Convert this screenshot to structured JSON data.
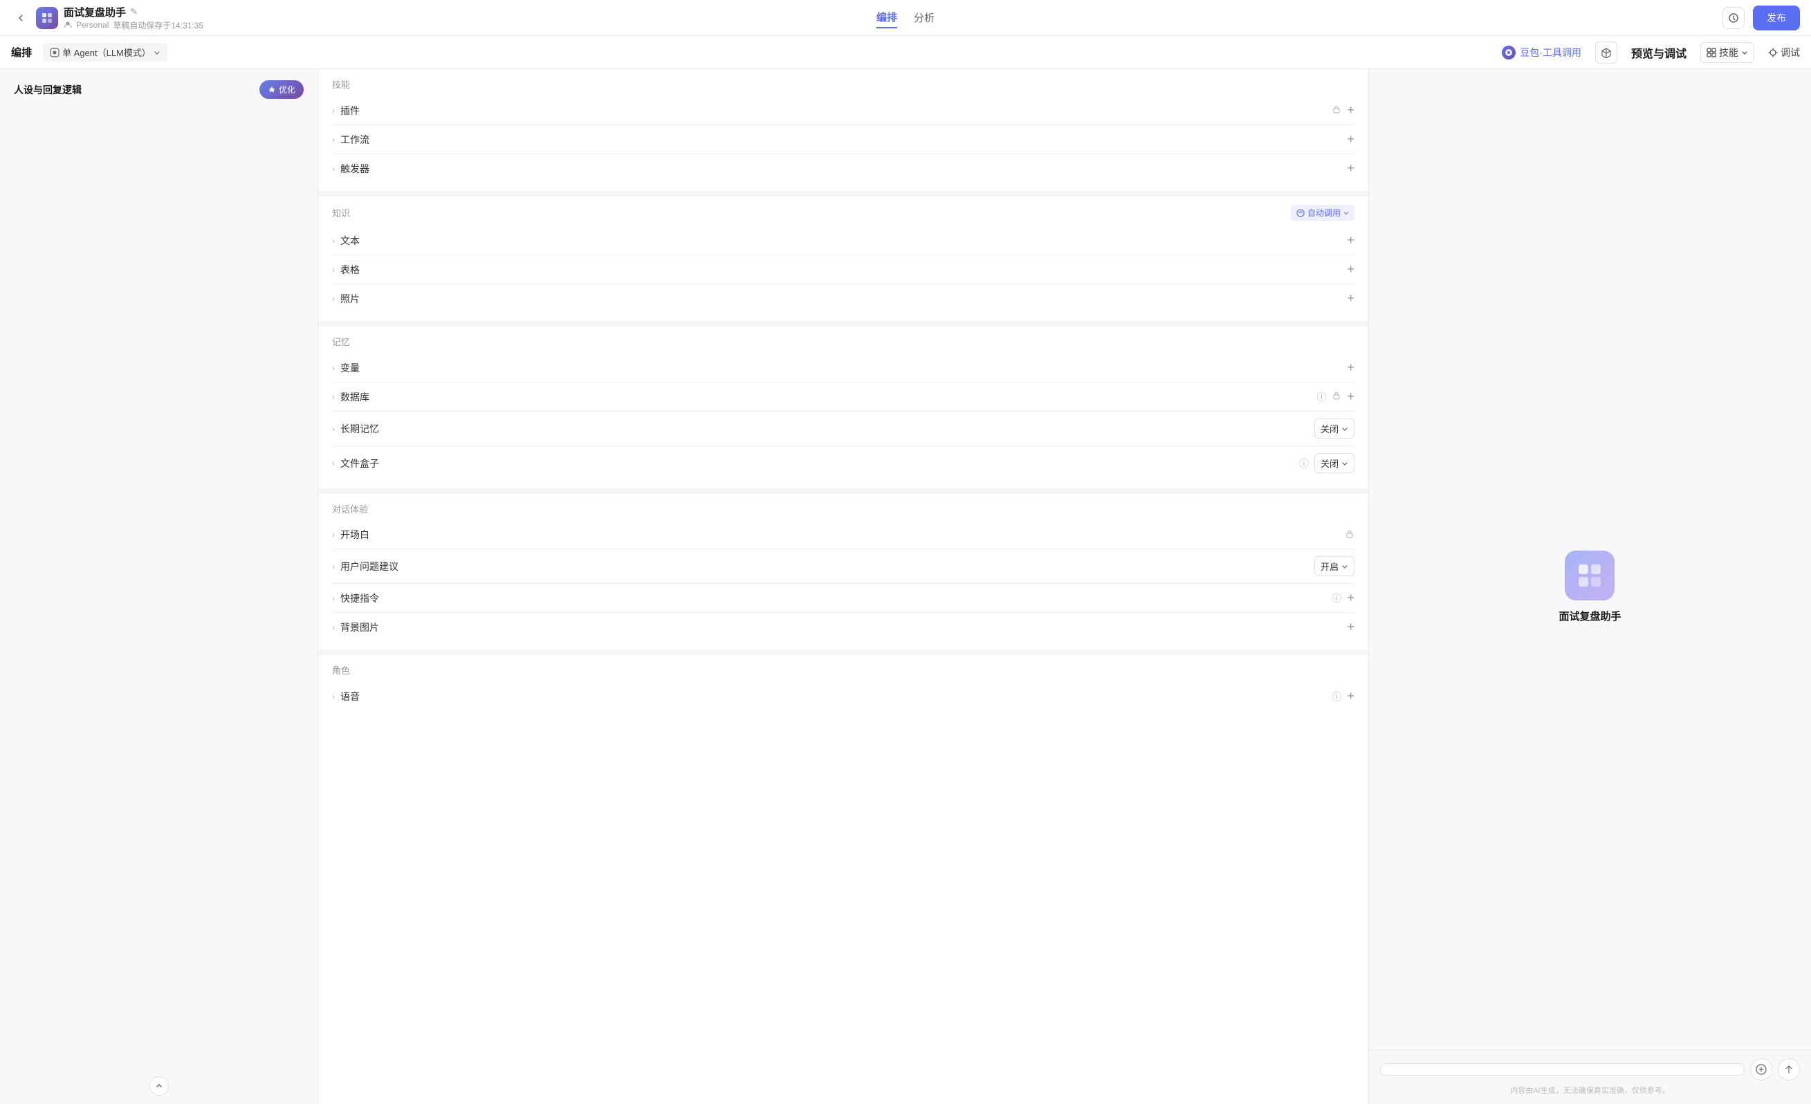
{
  "topbar": {
    "back_label": "‹",
    "app_icon": "🗂",
    "app_title": "面试复盘助手",
    "edit_icon": "✎",
    "personal_label": "Personal",
    "autosave_label": "草稿自动保存于14:31:35",
    "nav_tabs": [
      {
        "id": "edit",
        "label": "编排",
        "active": true
      },
      {
        "id": "analysis",
        "label": "分析",
        "active": false
      }
    ],
    "history_icon": "🕐",
    "publish_label": "发布"
  },
  "second_toolbar": {
    "label": "编排",
    "agent_mode_label": "单 Agent（LLM模式）",
    "doubao_tools_label": "豆包·工具调用",
    "plugin_icon": "⬡",
    "preview_label": "预览与调试",
    "skills_label": "技能",
    "debug_label": "调试"
  },
  "left_panel": {
    "title": "人设与回复逻辑",
    "optimize_label": "优化",
    "collapse_icon": "∧"
  },
  "skills_section": {
    "title": "技能",
    "items": [
      {
        "id": "plugin",
        "label": "插件",
        "has_lock": true,
        "has_add": true
      },
      {
        "id": "workflow",
        "label": "工作流",
        "has_lock": false,
        "has_add": true
      },
      {
        "id": "trigger",
        "label": "触发器",
        "has_lock": false,
        "has_add": true
      }
    ]
  },
  "knowledge_section": {
    "title": "知识",
    "auto_adjust_label": "自动调用",
    "items": [
      {
        "id": "text",
        "label": "文本",
        "has_lock": false,
        "has_add": true
      },
      {
        "id": "table",
        "label": "表格",
        "has_lock": false,
        "has_add": true
      },
      {
        "id": "photo",
        "label": "照片",
        "has_lock": false,
        "has_add": true
      }
    ]
  },
  "memory_section": {
    "title": "记忆",
    "items": [
      {
        "id": "variable",
        "label": "变量",
        "has_lock": false,
        "has_add": true
      },
      {
        "id": "database",
        "label": "数据库",
        "has_info": true,
        "has_lock": true,
        "has_add": true
      },
      {
        "id": "longterm",
        "label": "长期记忆",
        "has_dropdown": true,
        "dropdown_value": "关闭"
      },
      {
        "id": "filebox",
        "label": "文件盒子",
        "has_info": true,
        "has_dropdown": true,
        "dropdown_value": "关闭"
      }
    ]
  },
  "conversation_section": {
    "title": "对话体验",
    "items": [
      {
        "id": "opening",
        "label": "开场白",
        "has_lock": true
      },
      {
        "id": "suggestions",
        "label": "用户问题建议",
        "has_dropdown": true,
        "dropdown_value": "开启"
      },
      {
        "id": "shortcut",
        "label": "快捷指令",
        "has_info": true,
        "has_add": true
      },
      {
        "id": "background",
        "label": "背景图片",
        "has_add": true
      }
    ]
  },
  "role_section": {
    "title": "角色",
    "items": [
      {
        "id": "voice",
        "label": "语音",
        "has_info": true,
        "has_add": true
      }
    ]
  },
  "preview_panel": {
    "app_icon": "🗂",
    "app_name": "面试复盘助手",
    "input_placeholder": "",
    "disclaimer": "内容由AI生成，无法确保真实准确，仅供参考。"
  }
}
